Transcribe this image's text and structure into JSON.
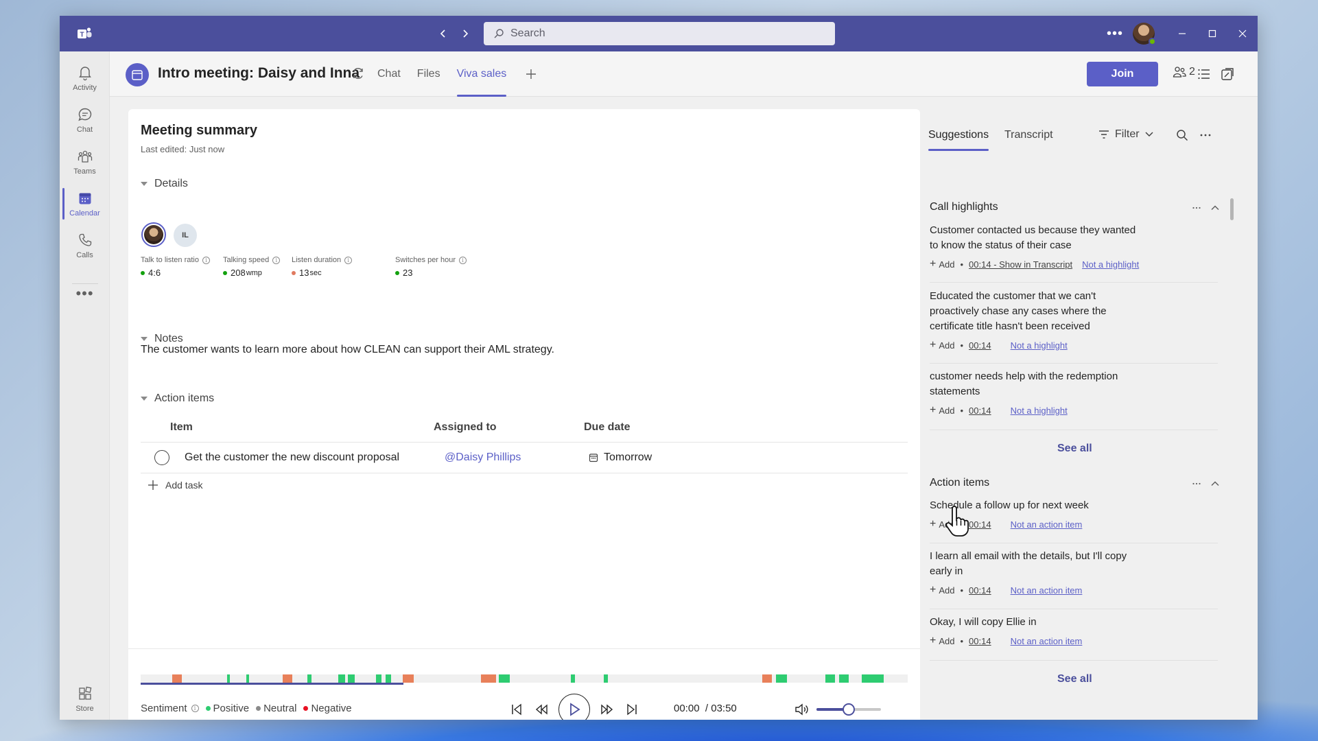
{
  "titlebar": {
    "search_placeholder": "Search",
    "more": "•••"
  },
  "rail": {
    "items": [
      {
        "label": "Activity",
        "icon": "bell-icon"
      },
      {
        "label": "Chat",
        "icon": "chat-icon"
      },
      {
        "label": "Teams",
        "icon": "teams-icon"
      },
      {
        "label": "Calendar",
        "icon": "calendar-icon",
        "active": true
      },
      {
        "label": "Calls",
        "icon": "phone-icon"
      }
    ],
    "more": "•••",
    "store": "Store"
  },
  "header": {
    "title": "Intro meeting: Daisy and Inna",
    "tabs": [
      {
        "label": "Chat"
      },
      {
        "label": "Files"
      },
      {
        "label": "Viva sales",
        "active": true
      }
    ],
    "join_label": "Join",
    "participants_count": "2"
  },
  "summary": {
    "title": "Meeting summary",
    "last_edited": "Last edited: Just now",
    "details_heading": "Details",
    "participant_initials": "IL",
    "metrics": [
      {
        "label": "Talk to listen ratio",
        "value": "4:6",
        "unit": "",
        "color": "#13a10e"
      },
      {
        "label": "Talking speed",
        "value": "208",
        "unit": "wmp",
        "color": "#13a10e"
      },
      {
        "label": "Listen duration",
        "value": "13",
        "unit": "sec",
        "color": "#e07a5f"
      },
      {
        "label": "Switches per hour",
        "value": "23",
        "unit": "",
        "color": "#13a10e"
      }
    ],
    "notes_heading": "Notes",
    "notes_text": "The customer wants to learn more about how CLEAN can support their AML strategy.",
    "action_items_heading": "Action items",
    "table": {
      "headers": {
        "item": "Item",
        "assigned": "Assigned to",
        "due": "Due date"
      },
      "rows": [
        {
          "item": "Get the customer the new discount proposal",
          "assigned": "@Daisy Phillips",
          "due": "Tomorrow"
        }
      ]
    },
    "add_task": "Add task"
  },
  "player": {
    "sentiment_label": "Sentiment",
    "legend": [
      {
        "label": "Positive",
        "color": "#2ecc71"
      },
      {
        "label": "Neutral",
        "color": "#8a8a8a"
      },
      {
        "label": "Negative",
        "color": "#e81123"
      }
    ],
    "current_time": "00:00",
    "total_time": "/ 03:50",
    "volume_level": 0.5,
    "progress_fraction": 0.343
  },
  "right_panel": {
    "tabs": [
      {
        "label": "Suggestions",
        "active": true
      },
      {
        "label": "Transcript"
      }
    ],
    "filter_label": "Filter",
    "call_highlights": {
      "heading": "Call highlights",
      "items": [
        {
          "text": "Customer contacted us because they wanted to know the status of their case",
          "add": "Add",
          "timestamp": "00:14 - Show in Transcript",
          "reject": "Not a highlight"
        },
        {
          "text": "Educated the customer that we can't proactively chase any cases where the certificate title hasn't been received",
          "add": "Add",
          "timestamp": "00:14",
          "reject": "Not a highlight"
        },
        {
          "text": "customer needs help with the redemption statements",
          "add": "Add",
          "timestamp": "00:14",
          "reject": "Not a highlight"
        }
      ],
      "see_all": "See all"
    },
    "action_items": {
      "heading": "Action items",
      "items": [
        {
          "text": "Schedule a follow up for next week",
          "add": "Add",
          "timestamp": "00:14",
          "reject": "Not an action item"
        },
        {
          "text": "I learn all email with the details, but I'll copy early in",
          "add": "Add",
          "timestamp": "00:14",
          "reject": "Not an action item"
        },
        {
          "text": "Okay, I will copy Ellie in",
          "add": "Add",
          "timestamp": "00:14",
          "reject": "Not an action item"
        }
      ],
      "see_all": "See all"
    }
  },
  "colors": {
    "brand": "#4b4f9c",
    "accent": "#5b5fc7",
    "positive": "#2ecc71",
    "negative": "#e8805a"
  }
}
